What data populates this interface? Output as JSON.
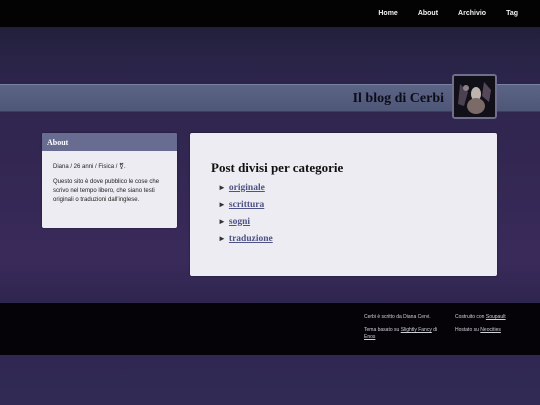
{
  "nav": {
    "items": [
      {
        "label": "Home"
      },
      {
        "label": "About"
      },
      {
        "label": "Archivio"
      },
      {
        "label": "Tag"
      }
    ]
  },
  "header": {
    "title": "Il blog di Cerbi"
  },
  "sidebar": {
    "heading": "About",
    "line1": "Diana / 26 anni / Fisica / ⚧.",
    "line2": "Questo sito è dove pubblico le cose che scrivo nel tempo libero, che siano testi originali o traduzioni dall'inglese."
  },
  "main": {
    "title": "Post divisi per categorie",
    "arrow": "►",
    "categories": [
      {
        "label": "originale"
      },
      {
        "label": "scrittura"
      },
      {
        "label": "sogni"
      },
      {
        "label": "traduzione"
      }
    ]
  },
  "footer": {
    "written_by": "Cerbi è scritto da Diana Cervi.",
    "theme_prefix": "Tema basato su",
    "theme_link": "Slightly Fancy",
    "theme_mid": "di",
    "theme_author": "Enos",
    "built_prefix": "Costruito con",
    "built_link": "Soupault",
    "hosted_prefix": "Hostato su",
    "hosted_link": "Neocities"
  }
}
